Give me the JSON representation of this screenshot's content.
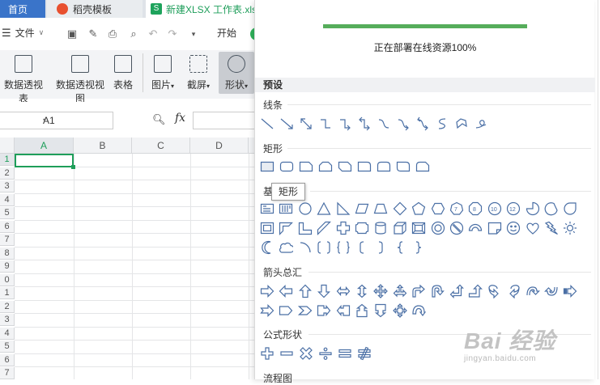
{
  "tabs": {
    "home": "首页",
    "docer": "稻壳模板",
    "file": "新建XLSX 工作表.xls"
  },
  "menu": {
    "file": "文件",
    "start": "开始"
  },
  "ribbon": {
    "pivot_table": "数据透视表",
    "pivot_chart": "数据透视视图",
    "table": "表格",
    "picture": "图片",
    "screenshot": "截屏",
    "shape": "形状"
  },
  "formula_bar": {
    "name_box": "A1",
    "fx": "fx"
  },
  "grid": {
    "columns": [
      "A",
      "B",
      "C",
      "D"
    ],
    "rows": [
      "1",
      "2",
      "3",
      "4",
      "5",
      "6",
      "7",
      "8",
      "9",
      "0",
      "1",
      "2",
      "3",
      "4",
      "5",
      "6",
      "7"
    ],
    "selected_cell": "A1",
    "accent_color": "#1e9e5a"
  },
  "shapes_panel": {
    "progress": {
      "fraction": 1.0,
      "text": "正在部署在线资源100%",
      "color": "#56ad5b"
    },
    "preset_header": "预设",
    "sections": {
      "lines": "线条",
      "rectangles": "矩形",
      "basic": "基",
      "arrows": "箭头总汇",
      "formula": "公式形状",
      "flowchart": "流程图"
    },
    "tooltip": "矩形"
  },
  "watermark": {
    "brand": "Bai 经验",
    "url": "jingyan.baidu.com"
  }
}
